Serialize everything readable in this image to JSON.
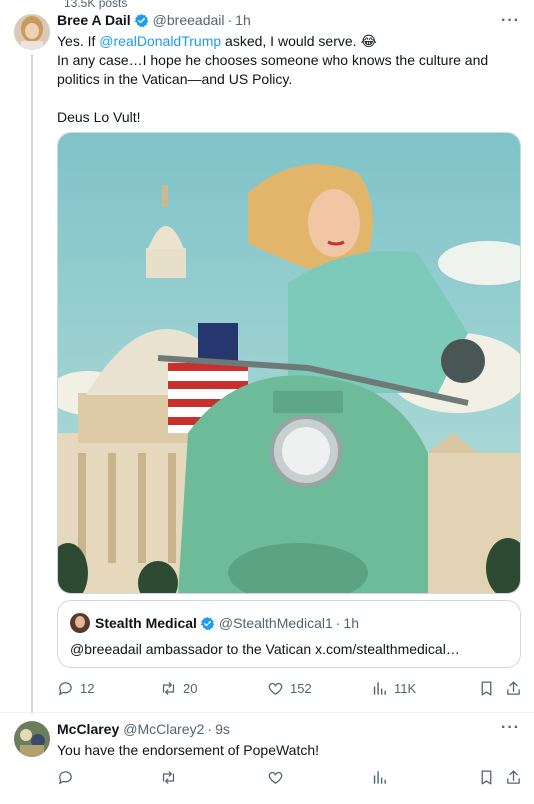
{
  "top_stat": "13.5K posts",
  "post1": {
    "name": "Bree A Dail",
    "handle": "@breeadail",
    "time": "1h",
    "text_line1_prefix": "Yes. If ",
    "text_line1_mention": "@realDonaldTrump",
    "text_line1_suffix": " asked, I would serve. ",
    "text_line1_emoji": "😂",
    "text_line2": "In any case…I hope he chooses someone who knows the culture and",
    "text_line3": "politics in the Vatican—and US Policy.",
    "text_line4": "Deus Lo Vult!",
    "quote": {
      "name": "Stealth Medical",
      "handle": "@StealthMedical1",
      "time": "1h",
      "text": "@breeadail ambassador to the Vatican x.com/stealthmedical…"
    },
    "actions": {
      "replies": "12",
      "reposts": "20",
      "likes": "152",
      "views": "11K"
    }
  },
  "post2": {
    "name": "McClarey",
    "handle": "@McClarey2",
    "time": "9s",
    "text": "You have the endorsement of PopeWatch!"
  },
  "colors": {
    "accent": "#1d9bf0",
    "muted": "#536471",
    "border": "#cfd9de"
  }
}
